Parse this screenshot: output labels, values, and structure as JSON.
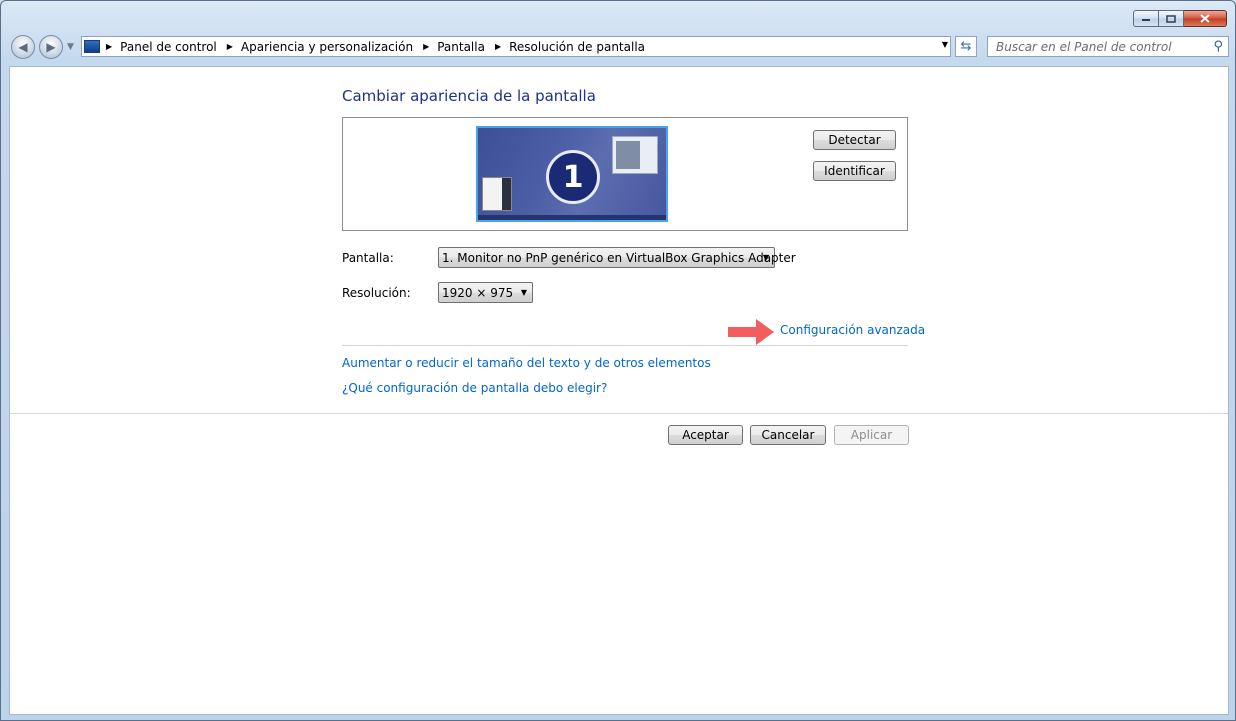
{
  "titlebar": {
    "minimize_icon": "minimize-icon",
    "maximize_icon": "maximize-icon",
    "close_icon": "close-icon"
  },
  "nav": {
    "breadcrumb": [
      "Panel de control",
      "Apariencia y personalización",
      "Pantalla",
      "Resolución de pantalla"
    ],
    "search_placeholder": "Buscar en el Panel de control"
  },
  "main": {
    "title": "Cambiar apariencia de la pantalla",
    "monitor_number": "1",
    "detect_button": "Detectar",
    "identify_button": "Identificar",
    "display_label": "Pantalla:",
    "display_value": "1. Monitor no PnP genérico en VirtualBox Graphics Adapter",
    "resolution_label": "Resolución:",
    "resolution_value": "1920 × 975",
    "advanced_link": "Configuración avanzada",
    "text_size_link": "Aumentar o reducir el tamaño del texto y de otros elementos",
    "help_link": "¿Qué configuración de pantalla debo elegir?"
  },
  "footer": {
    "ok_button": "Aceptar",
    "cancel_button": "Cancelar",
    "apply_button": "Aplicar"
  },
  "colors": {
    "title": "#1e3287",
    "link": "#0066cc",
    "arrow": "#f25d5d"
  }
}
